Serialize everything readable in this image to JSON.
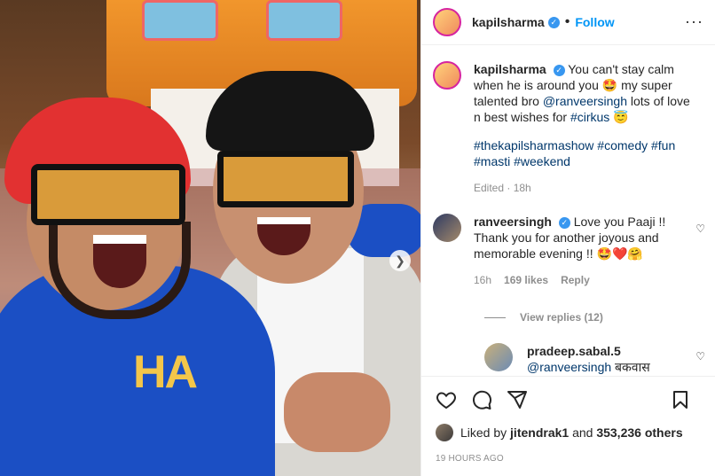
{
  "post": {
    "username": "kapilsharma",
    "follow_label": "Follow",
    "dot": "•",
    "caption_text": "You can't stay calm when he is around you 🤩 my super talented bro",
    "caption_mention": "@ranveersingh",
    "caption_text2": "lots of love n best wishes for",
    "caption_tag": "#cirkus",
    "caption_emoji": "😇",
    "tags": [
      "#thekapilsharmashow",
      "#comedy",
      "#fun",
      "#masti",
      "#weekend"
    ],
    "edited": "Edited · 18h"
  },
  "comments": [
    {
      "username": "ranveersingh",
      "text": "Love you Paaji !! Thank you for another joyous and memorable evening !! 🤩❤️🤗",
      "time": "16h",
      "likes": "169 likes",
      "reply_label": "Reply",
      "view_replies": "View replies (12)"
    },
    {
      "username": "pradeep.sabal.5",
      "mention": "@ranveersingh",
      "text": "बकवास"
    }
  ],
  "photo": {
    "hoodie_text": "HA"
  },
  "footer": {
    "liked_by_prefix": "Liked by",
    "liked_by_user": "jitendrak1",
    "liked_by_suffix": "and",
    "liked_by_count": "353,236 others",
    "time_ago": "19 HOURS AGO"
  },
  "colors": {
    "accent": "#0095f6",
    "verified": "#3897f0",
    "muted": "#8e8e8e"
  },
  "icons": [
    "heart-icon",
    "comment-icon",
    "share-icon",
    "bookmark-icon",
    "chevron-right-icon",
    "verified-icon",
    "more-icon"
  ]
}
